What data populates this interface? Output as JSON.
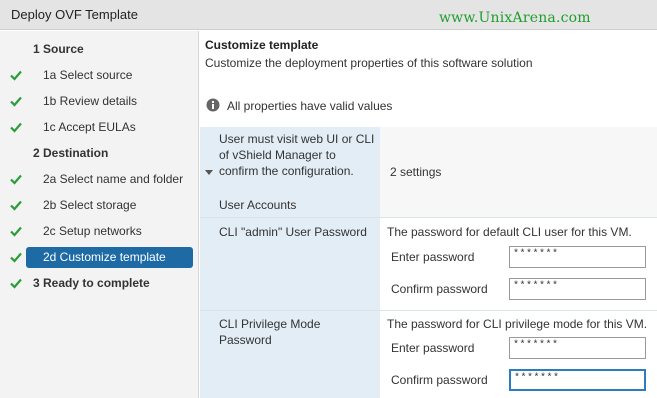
{
  "window": {
    "title": "Deploy OVF Template"
  },
  "watermark": "www.UnixArena.com",
  "sidebar": {
    "steps": [
      {
        "label": "1  Source",
        "checked": false,
        "kind": "section"
      },
      {
        "label": "1a  Select source",
        "checked": true,
        "kind": "sub"
      },
      {
        "label": "1b  Review details",
        "checked": true,
        "kind": "sub"
      },
      {
        "label": "1c  Accept EULAs",
        "checked": true,
        "kind": "sub"
      },
      {
        "label": "2  Destination",
        "checked": false,
        "kind": "section"
      },
      {
        "label": "2a  Select name and folder",
        "checked": true,
        "kind": "sub"
      },
      {
        "label": "2b  Select storage",
        "checked": true,
        "kind": "sub"
      },
      {
        "label": "2c  Setup networks",
        "checked": true,
        "kind": "sub"
      },
      {
        "label": "2d  Customize template",
        "checked": true,
        "kind": "sub",
        "active": true
      },
      {
        "label": "3  Ready to complete",
        "checked": true,
        "kind": "section"
      }
    ]
  },
  "main": {
    "title": "Customize template",
    "subtitle": "Customize the deployment properties of this software solution",
    "info": "All properties have valid values"
  },
  "properties": {
    "group": {
      "label_line1": "User must visit web UI or CLI",
      "label_line2": "of vShield Manager to",
      "label_line3": "confirm the configuration.",
      "summary": "2 settings",
      "category": "User Accounts"
    },
    "admin_password": {
      "label": "CLI \"admin\" User Password",
      "description": "The password for default CLI user for this VM.",
      "enter_label": "Enter password",
      "enter_value": "*******",
      "confirm_label": "Confirm password",
      "confirm_value": "*******"
    },
    "privilege_password": {
      "label_line1": "CLI Privilege Mode",
      "label_line2": "Password",
      "description": "The password for CLI privilege mode for this VM.",
      "enter_label": "Enter password",
      "enter_value": "*******",
      "confirm_label": "Confirm password",
      "confirm_value": "*******"
    }
  },
  "colors": {
    "accent": "#1d6aa5",
    "check": "#2a9d3a",
    "watermark": "#1e9e2e",
    "label_column": "#e3edf5"
  },
  "icons": {
    "check": "check-icon",
    "info": "info-icon",
    "expand": "caret-down-icon"
  }
}
